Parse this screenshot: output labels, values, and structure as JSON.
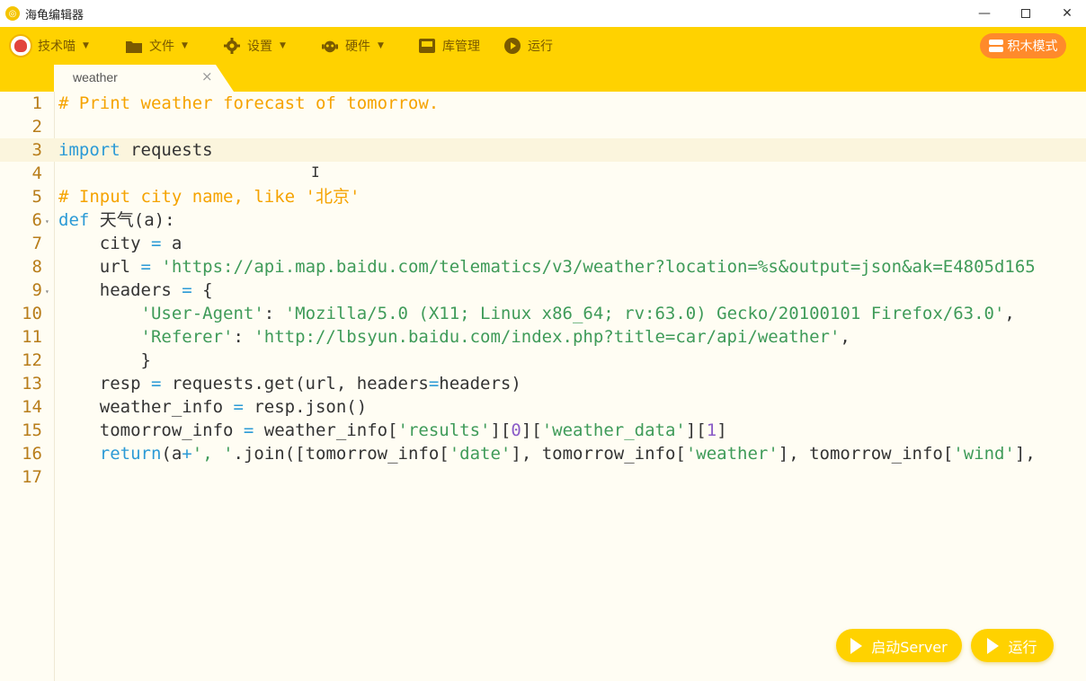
{
  "window": {
    "title": "海龟编辑器",
    "minimize": "—",
    "close": "✕"
  },
  "toolbar": {
    "user": "技术喵",
    "file": "文件",
    "settings": "设置",
    "hardware": "硬件",
    "library": "库管理",
    "run": "运行",
    "block_mode": "积木模式"
  },
  "tab": {
    "label": "weather",
    "close": "×"
  },
  "editor": {
    "lines": [
      {
        "n": "1",
        "text": "# Print weather forecast of tomorrow."
      },
      {
        "n": "2",
        "text": ""
      },
      {
        "n": "3",
        "text": "import requests"
      },
      {
        "n": "4",
        "text": ""
      },
      {
        "n": "5",
        "text": "# Input city name, like '北京'"
      },
      {
        "n": "6",
        "text": "def 天气(a):"
      },
      {
        "n": "7",
        "text": "    city = a"
      },
      {
        "n": "8",
        "text": "    url = 'https://api.map.baidu.com/telematics/v3/weather?location=%s&output=json&ak=E4805d165"
      },
      {
        "n": "9",
        "text": "    headers = {"
      },
      {
        "n": "10",
        "text": "        'User-Agent': 'Mozilla/5.0 (X11; Linux x86_64; rv:63.0) Gecko/20100101 Firefox/63.0',"
      },
      {
        "n": "11",
        "text": "        'Referer': 'http://lbsyun.baidu.com/index.php?title=car/api/weather',"
      },
      {
        "n": "12",
        "text": "        }"
      },
      {
        "n": "13",
        "text": "    resp = requests.get(url, headers=headers)"
      },
      {
        "n": "14",
        "text": "    weather_info = resp.json()"
      },
      {
        "n": "15",
        "text": "    tomorrow_info = weather_info['results'][0]['weather_data'][1]"
      },
      {
        "n": "16",
        "text": "    return(a+', '.join([tomorrow_info['date'], tomorrow_info['weather'], tomorrow_info['wind'],"
      },
      {
        "n": "17",
        "text": ""
      }
    ],
    "folded_lines": [
      "6",
      "9"
    ],
    "cursor_glyph": "I"
  },
  "buttons": {
    "start_server": "启动Server",
    "run": "运行"
  },
  "colors": {
    "toolbar_bg": "#ffd200",
    "editor_bg": "#fffdf3",
    "comment": "#f5a300",
    "keyword": "#2b9ad6",
    "string": "#3f9b59",
    "number": "#8a5cc7",
    "line_number": "#b87d1a",
    "block_mode_bg": "#ff8a2b"
  }
}
